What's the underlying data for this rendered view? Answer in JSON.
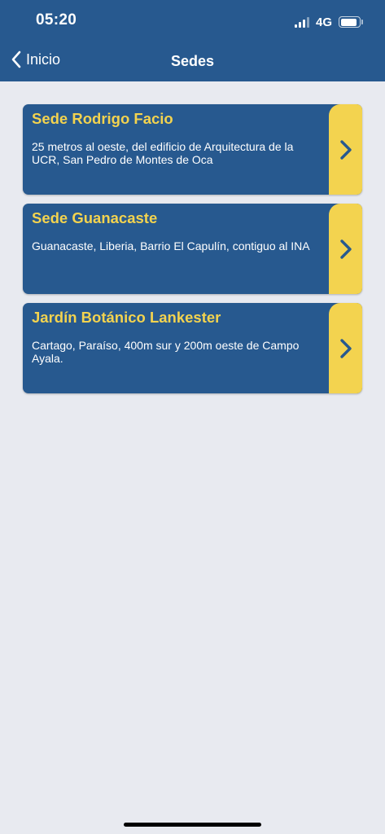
{
  "status_bar": {
    "time": "05:20",
    "network": "4G"
  },
  "nav": {
    "back_label": "Inicio",
    "title": "Sedes"
  },
  "sedes": [
    {
      "name": "Sede Rodrigo Facio",
      "address": "25 metros al oeste, del edificio de Arquitectura de la UCR, San Pedro de Montes de Oca"
    },
    {
      "name": "Sede Guanacaste",
      "address": "Guanacaste, Liberia, Barrio El Capulín, contiguo al INA"
    },
    {
      "name": "Jardín Botánico Lankester",
      "address": "Cartago, Paraíso, 400m sur y 200m oeste de Campo Ayala."
    }
  ],
  "colors": {
    "brand_blue": "#27598f",
    "accent_yellow": "#f3d34f",
    "background": "#e8eaf0"
  }
}
